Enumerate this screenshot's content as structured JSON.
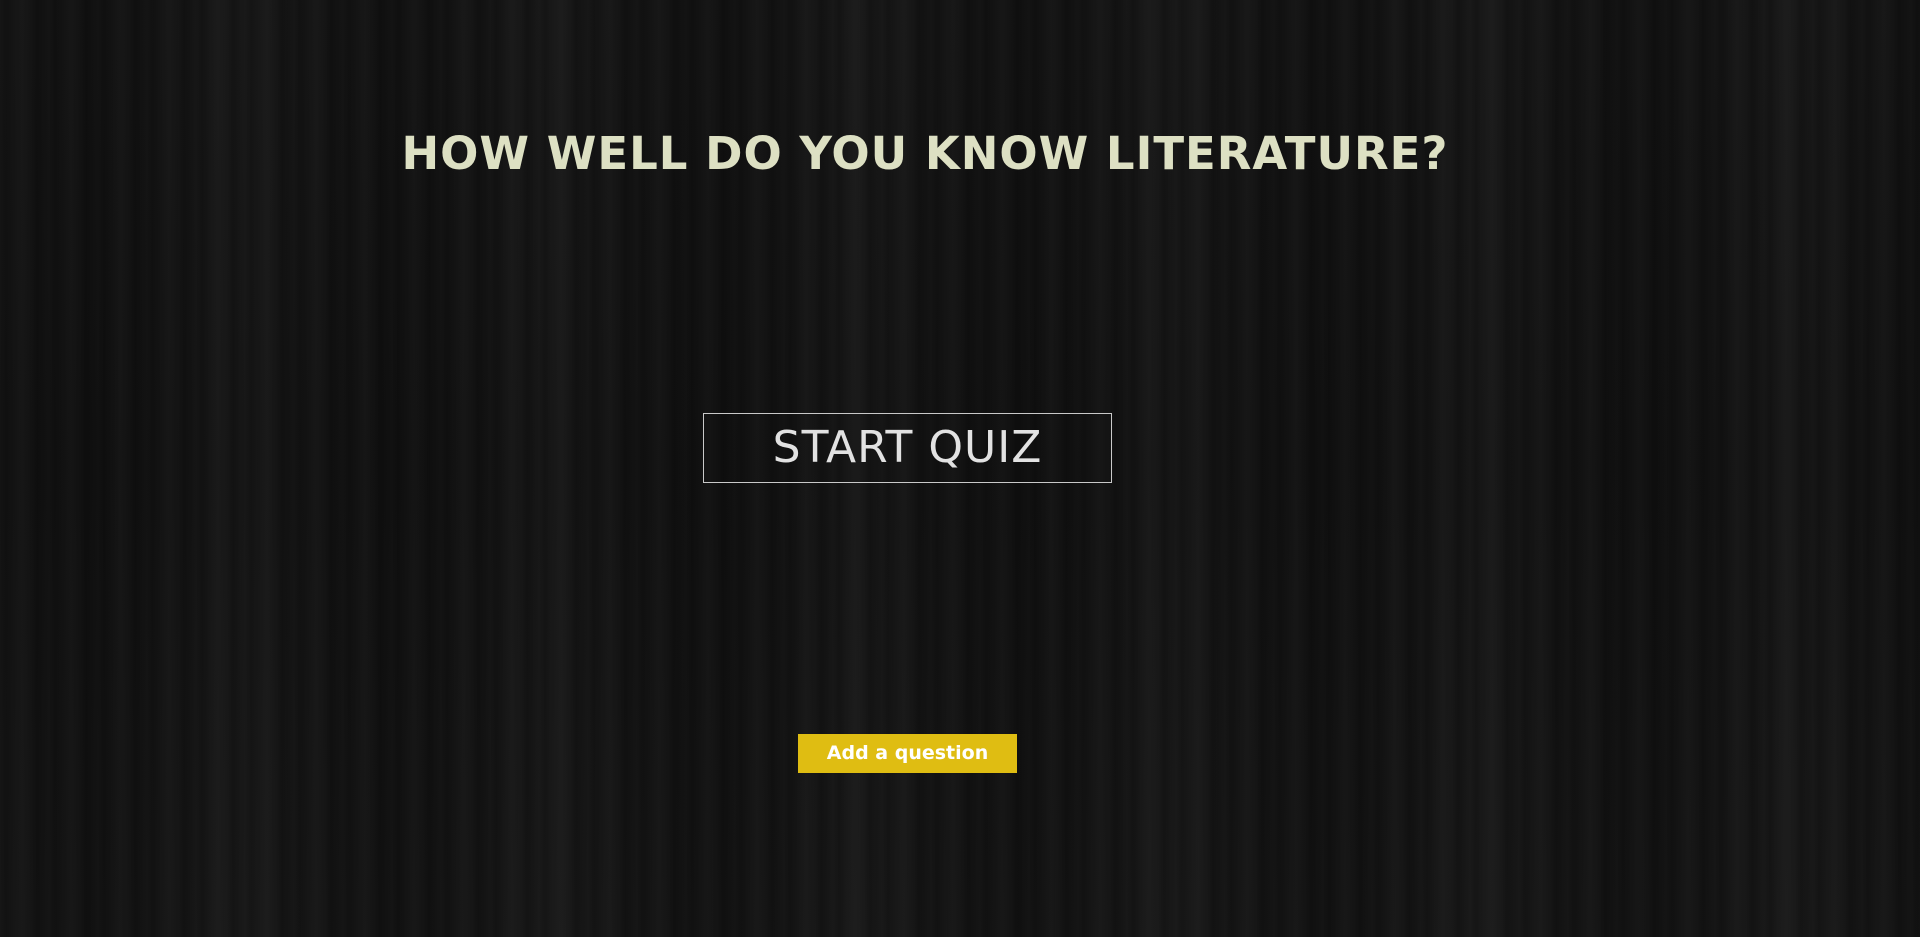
{
  "page": {
    "title": "HOW WELL DO YOU KNOW LITERATURE?"
  },
  "actions": {
    "start_label": "START QUIZ",
    "add_question_label": "Add a question"
  },
  "colors": {
    "background": "#141414",
    "title_text": "#dde0c3",
    "start_border": "#c9c9c9",
    "start_text": "#e2e2e2",
    "accent": "#dfbd12",
    "accent_text": "#ffffff"
  }
}
